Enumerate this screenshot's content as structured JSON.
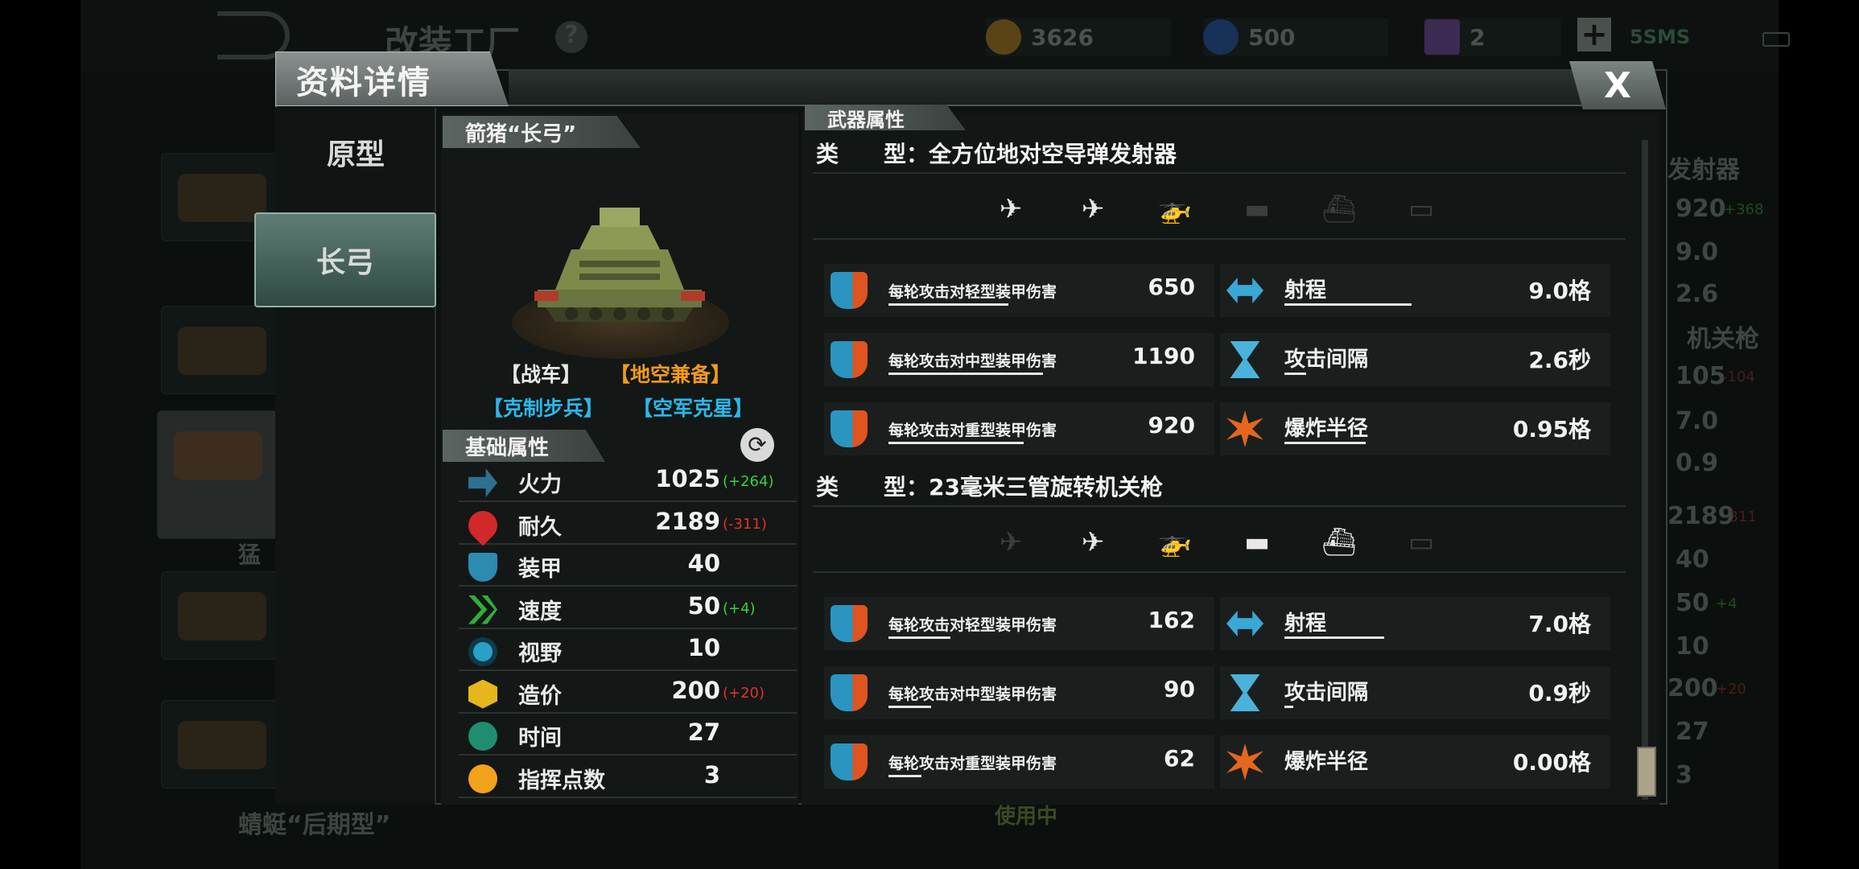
{
  "background": {
    "factory_title": "改装工厂",
    "help": "?",
    "gold": "3626",
    "gems": "500",
    "cards": "2",
    "plus": "+",
    "network": "5SMS",
    "list_bottom": "蜻蜓“后期型”",
    "in_use": "使用中",
    "right_header": "发射器",
    "right_header2": "机关枪",
    "right_values": [
      "920",
      "9.0",
      "2.6",
      "105",
      "7.0",
      "0.9",
      "2189",
      "40",
      "50",
      "10",
      "200",
      "27",
      "3"
    ],
    "right_bonuses": [
      "+368",
      "-104",
      "-311",
      "+4",
      "+20"
    ],
    "left_item": "猛"
  },
  "dialog": {
    "title": "资料详情",
    "close": "X",
    "tabs": [
      {
        "label": "原型"
      },
      {
        "label": "长弓"
      }
    ],
    "unit_name": "箭猪“长弓”",
    "tags": [
      {
        "text": "【战车】",
        "color": "#e8e8e8"
      },
      {
        "text": "【地空兼备】",
        "color": "#f29a1b"
      },
      {
        "text": "【克制步兵】",
        "color": "#2ab7e8"
      },
      {
        "text": "【空军克星】",
        "color": "#2ab7e8"
      }
    ],
    "basic_header": "基础属性",
    "attributes": [
      {
        "name": "火力",
        "value": "1025",
        "bonus": "(+264)",
        "bonus_color": "#37d23a",
        "icon": "firepower-icon"
      },
      {
        "name": "耐久",
        "value": "2189",
        "bonus": "(-311)",
        "bonus_color": "#e0312b",
        "icon": "heart-icon"
      },
      {
        "name": "装甲",
        "value": "40",
        "bonus": "",
        "bonus_color": "",
        "icon": "armor-icon"
      },
      {
        "name": "速度",
        "value": "50",
        "bonus": "(+4)",
        "bonus_color": "#37d23a",
        "icon": "speed-icon"
      },
      {
        "name": "视野",
        "value": "10",
        "bonus": "",
        "bonus_color": "",
        "icon": "eye-icon"
      },
      {
        "name": "造价",
        "value": "200",
        "bonus": "(+20)",
        "bonus_color": "#e0312b",
        "icon": "cost-icon"
      },
      {
        "name": "时间",
        "value": "27",
        "bonus": "",
        "bonus_color": "",
        "icon": "clock-icon"
      },
      {
        "name": "指挥点数",
        "value": "3",
        "bonus": "",
        "bonus_color": "",
        "icon": "command-star-icon"
      }
    ],
    "weapon_header": "武器属性",
    "weapons": [
      {
        "type_label": "类　　型：",
        "type": "全方位地对空导弹发射器",
        "targets": [
          {
            "icon": "jet-icon",
            "active": true
          },
          {
            "icon": "plane-icon",
            "active": true
          },
          {
            "icon": "helicopter-icon",
            "active": true
          },
          {
            "icon": "tank-icon",
            "active": false
          },
          {
            "icon": "ship-icon",
            "active": false
          },
          {
            "icon": "submarine-icon",
            "active": false
          }
        ],
        "stats": [
          {
            "name": "每轮攻击对轻型装甲伤害",
            "value": "650",
            "level": 0.62,
            "icon": "light-armor-icon"
          },
          {
            "name": "射程",
            "value": "9.0格",
            "level": 0.7,
            "icon": "range-icon"
          },
          {
            "name": "每轮攻击对中型装甲伤害",
            "value": "1190",
            "level": 0.8,
            "icon": "medium-armor-icon"
          },
          {
            "name": "攻击间隔",
            "value": "2.6秒",
            "level": 0.12,
            "icon": "hourglass-icon"
          },
          {
            "name": "每轮攻击对重型装甲伤害",
            "value": "920",
            "level": 0.7,
            "icon": "heavy-armor-icon"
          },
          {
            "name": "爆炸半径",
            "value": "0.95格",
            "level": 0.45,
            "icon": "explosion-icon"
          }
        ]
      },
      {
        "type_label": "类　　型：",
        "type": "23毫米三管旋转机关枪",
        "targets": [
          {
            "icon": "jet-icon",
            "active": false
          },
          {
            "icon": "plane-icon",
            "active": true
          },
          {
            "icon": "helicopter-icon",
            "active": true
          },
          {
            "icon": "tank-icon",
            "active": true
          },
          {
            "icon": "ship-icon",
            "active": true
          },
          {
            "icon": "submarine-icon",
            "active": false
          }
        ],
        "stats": [
          {
            "name": "每轮攻击对轻型装甲伤害",
            "value": "162",
            "level": 0.32,
            "icon": "light-armor-icon"
          },
          {
            "name": "射程",
            "value": "7.0格",
            "level": 0.55,
            "icon": "range-icon"
          },
          {
            "name": "每轮攻击对中型装甲伤害",
            "value": "90",
            "level": 0.22,
            "icon": "medium-armor-icon"
          },
          {
            "name": "攻击间隔",
            "value": "0.9秒",
            "level": 0.05,
            "icon": "hourglass-icon"
          },
          {
            "name": "每轮攻击对重型装甲伤害",
            "value": "62",
            "level": 0.17,
            "icon": "heavy-armor-icon"
          },
          {
            "name": "爆炸半径",
            "value": "0.00格",
            "level": 0.0,
            "icon": "explosion-icon"
          }
        ]
      }
    ]
  }
}
